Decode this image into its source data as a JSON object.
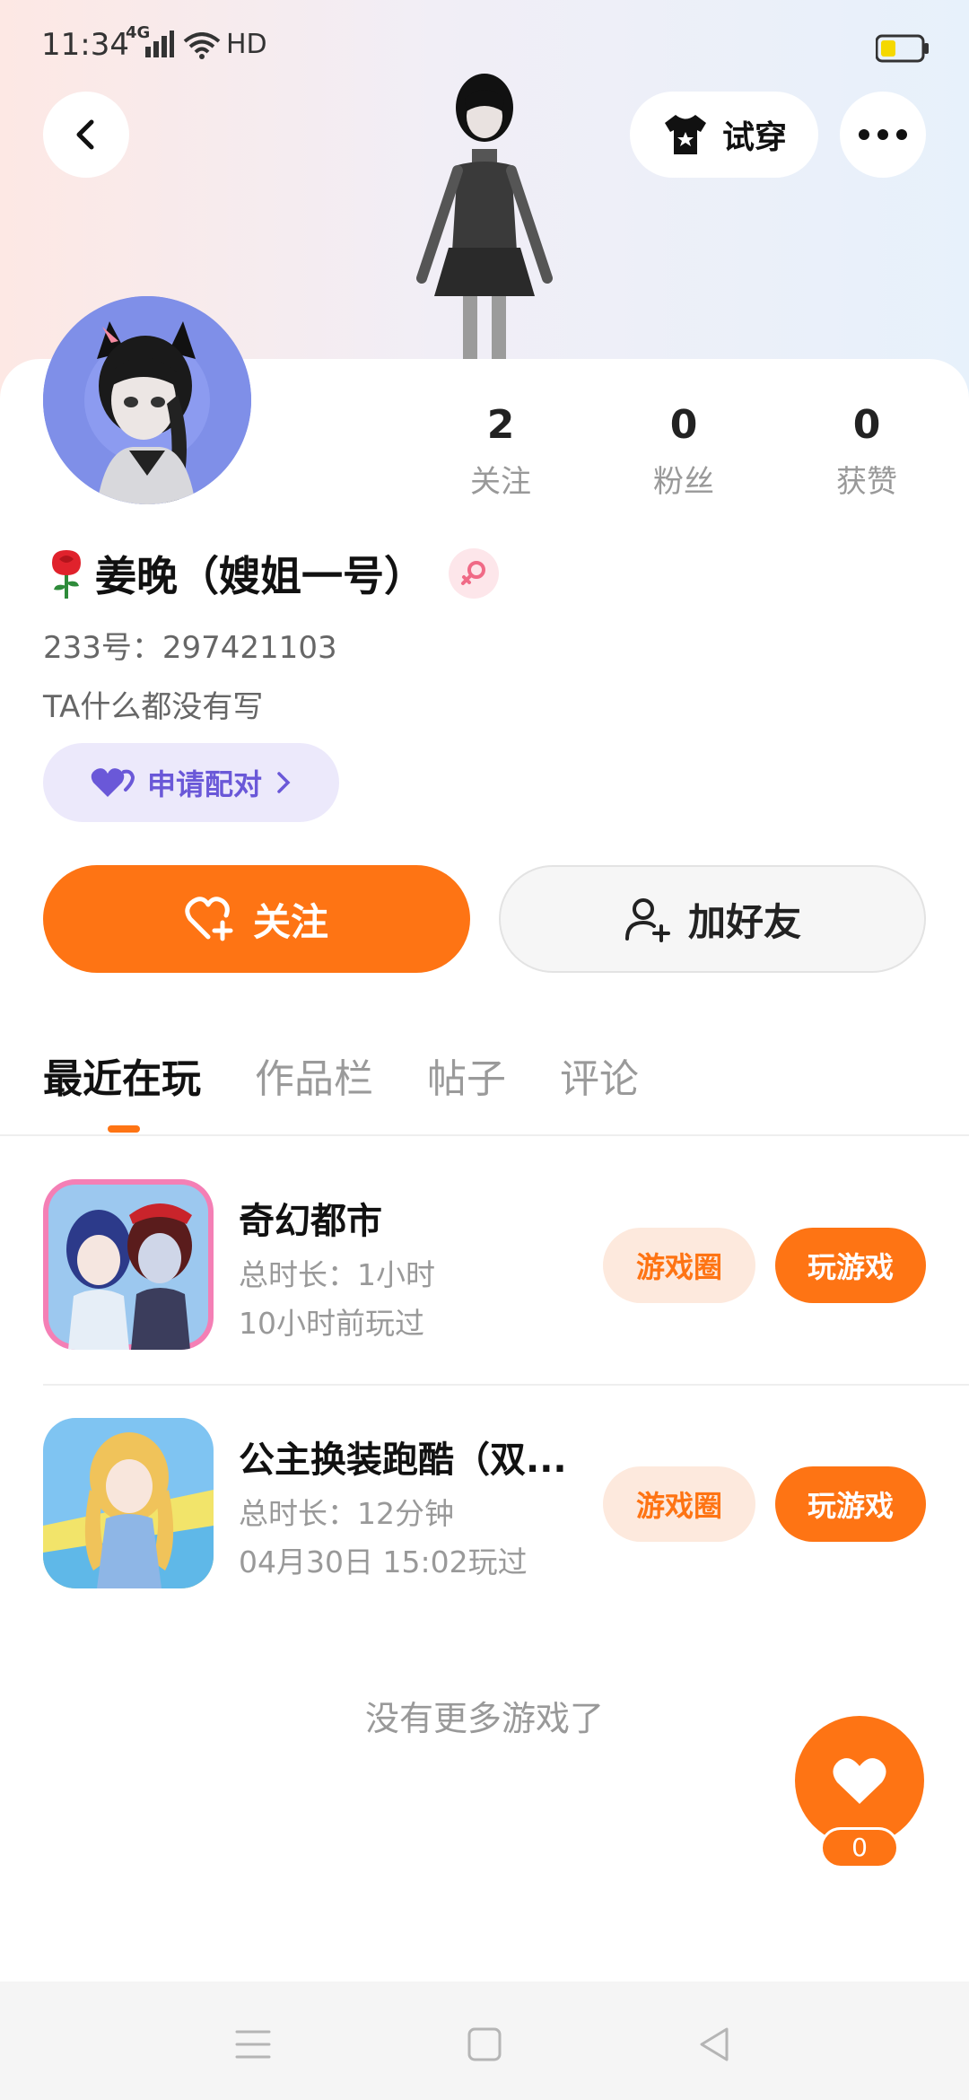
{
  "status_bar": {
    "time": "11:34",
    "network": "4G",
    "extra": "HD"
  },
  "header": {
    "tryon_label": "试穿"
  },
  "profile": {
    "stats": [
      {
        "value": "2",
        "label": "关注"
      },
      {
        "value": "0",
        "label": "粉丝"
      },
      {
        "value": "0",
        "label": "获赞"
      }
    ],
    "nickname": "姜晚（嫂姐一号）",
    "uid": "233号：297421103",
    "bio": "TA什么都没有写",
    "pair_label": "申请配对"
  },
  "actions": {
    "follow_label": "关注",
    "add_friend_label": "加好友"
  },
  "tabs": [
    {
      "label": "最近在玩",
      "active": true
    },
    {
      "label": "作品栏",
      "active": false
    },
    {
      "label": "帖子",
      "active": false
    },
    {
      "label": "评论",
      "active": false
    }
  ],
  "games": [
    {
      "title": "奇幻都市",
      "duration": "总时长：1小时",
      "last_played": "10小时前玩过",
      "circle_label": "游戏圈",
      "play_label": "玩游戏"
    },
    {
      "title": "公主换装跑酷（双...",
      "duration": "总时长：12分钟",
      "last_played": "04月30日 15:02玩过",
      "circle_label": "游戏圈",
      "play_label": "玩游戏"
    }
  ],
  "list_footer": "没有更多游戏了",
  "like": {
    "count": "0"
  },
  "colors": {
    "accent": "#fe7414",
    "pair": "#6a58d8"
  }
}
